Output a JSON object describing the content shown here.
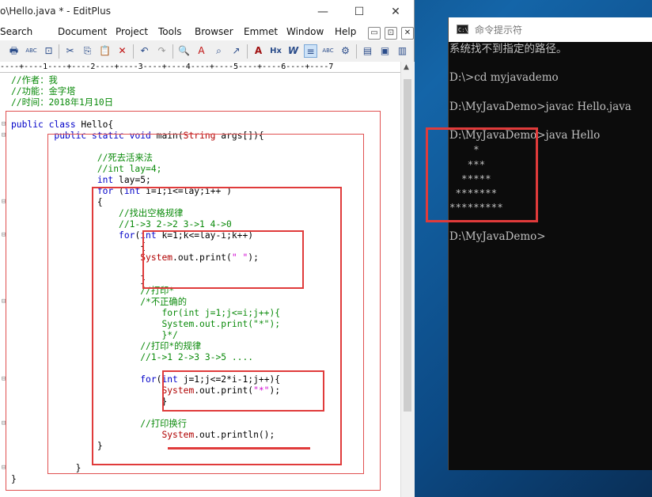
{
  "editplus": {
    "title": "o\\Hello.java * - EditPlus",
    "controls": {
      "minimize": "—",
      "maximize": "☐",
      "close": "✕"
    },
    "menu": [
      "Search",
      "Document",
      "Project",
      "Tools",
      "Browser",
      "Emmet",
      "Window",
      "Help"
    ],
    "menu_buttons": [
      "▭",
      "⊡",
      "✕"
    ],
    "ruler": "----+----1----+----2----+----3----+----4----+----5----+----6----+----7",
    "toolbar": {
      "print_icon": "🖶",
      "spell_icon": "ABC",
      "preview_icon": "⊡",
      "cut_icon": "✂",
      "copy_icon": "⎘",
      "paste_icon": "📋",
      "delete_icon": "✕",
      "undo_icon": "↶",
      "redo_icon": "↷",
      "find_icon": "🔍",
      "replace_icon": "A",
      "findfiles_icon": "⌕",
      "goto_icon": "↗",
      "font_icon": "A",
      "hex_icon": "Hx",
      "wordwrap_icon": "W",
      "lines_icon": "≡",
      "abc_icon": "ABC",
      "settings_icon": "⚙",
      "view1_icon": "▤",
      "view2_icon": "▣",
      "view3_icon": "▥"
    },
    "code_lines": [
      [
        {
          "c": "cm",
          "t": "//作者：我"
        }
      ],
      [
        {
          "c": "cm",
          "t": "//功能：金字塔"
        }
      ],
      [
        {
          "c": "cm",
          "t": "//时间：2018年1月10日"
        }
      ],
      [],
      [
        {
          "c": "kw",
          "t": "public class "
        },
        {
          "c": "tx",
          "t": "Hello{"
        }
      ],
      [
        {
          "c": "tx",
          "t": "        "
        },
        {
          "c": "kw",
          "t": "public static void "
        },
        {
          "c": "tx",
          "t": "main("
        },
        {
          "c": "ty",
          "t": "String"
        },
        {
          "c": "tx",
          "t": " args[]){"
        }
      ],
      [],
      [
        {
          "c": "tx",
          "t": "                "
        },
        {
          "c": "cm",
          "t": "//死去活来法"
        }
      ],
      [
        {
          "c": "tx",
          "t": "                "
        },
        {
          "c": "cm",
          "t": "//int lay=4;"
        }
      ],
      [
        {
          "c": "tx",
          "t": "                "
        },
        {
          "c": "kw",
          "t": "int "
        },
        {
          "c": "tx",
          "t": "lay=5;"
        }
      ],
      [
        {
          "c": "tx",
          "t": "                "
        },
        {
          "c": "kw",
          "t": "for "
        },
        {
          "c": "tx",
          "t": "("
        },
        {
          "c": "kw",
          "t": "int "
        },
        {
          "c": "tx",
          "t": "i=1;i<=lay;i++ )"
        }
      ],
      [
        {
          "c": "tx",
          "t": "                {"
        }
      ],
      [
        {
          "c": "tx",
          "t": "                    "
        },
        {
          "c": "cm",
          "t": "//找出空格规律"
        }
      ],
      [
        {
          "c": "tx",
          "t": "                    "
        },
        {
          "c": "cm",
          "t": "//1->3 2->2 3->1 4->0"
        }
      ],
      [
        {
          "c": "tx",
          "t": "                    "
        },
        {
          "c": "kw",
          "t": "for"
        },
        {
          "c": "tx",
          "t": "("
        },
        {
          "c": "kw",
          "t": "int "
        },
        {
          "c": "tx",
          "t": "k=1;k<=lay-i;k++)"
        }
      ],
      [
        {
          "c": "tx",
          "t": "                        {"
        }
      ],
      [
        {
          "c": "tx",
          "t": "                        "
        },
        {
          "c": "ty",
          "t": "System"
        },
        {
          "c": "tx",
          "t": ".out.print("
        },
        {
          "c": "st",
          "t": "\" \""
        },
        {
          "c": "tx",
          "t": ");"
        }
      ],
      [],
      [
        {
          "c": "tx",
          "t": "                        }"
        }
      ],
      [
        {
          "c": "tx",
          "t": "                        "
        },
        {
          "c": "cm",
          "t": "//打印*"
        }
      ],
      [
        {
          "c": "tx",
          "t": "                        "
        },
        {
          "c": "cm",
          "t": "/*不正确的"
        }
      ],
      [
        {
          "c": "tx",
          "t": "                            "
        },
        {
          "c": "cm",
          "t": "for(int j=1;j<=i;j++){"
        }
      ],
      [
        {
          "c": "tx",
          "t": "                            "
        },
        {
          "c": "cm",
          "t": "System.out.print(\"*\");"
        }
      ],
      [
        {
          "c": "tx",
          "t": "                            "
        },
        {
          "c": "cm",
          "t": "}*/"
        }
      ],
      [
        {
          "c": "tx",
          "t": "                        "
        },
        {
          "c": "cm",
          "t": "//打印*的规律"
        }
      ],
      [
        {
          "c": "tx",
          "t": "                        "
        },
        {
          "c": "cm",
          "t": "//1->1 2->3 3->5 ...."
        }
      ],
      [],
      [
        {
          "c": "tx",
          "t": "                        "
        },
        {
          "c": "kw",
          "t": "for"
        },
        {
          "c": "tx",
          "t": "("
        },
        {
          "c": "kw",
          "t": "int "
        },
        {
          "c": "tx",
          "t": "j=1;j<=2*i-1;j++){"
        }
      ],
      [
        {
          "c": "tx",
          "t": "                            "
        },
        {
          "c": "ty",
          "t": "System"
        },
        {
          "c": "tx",
          "t": ".out.print("
        },
        {
          "c": "st",
          "t": "\"*\""
        },
        {
          "c": "tx",
          "t": ");"
        }
      ],
      [
        {
          "c": "tx",
          "t": "                            }"
        }
      ],
      [],
      [
        {
          "c": "tx",
          "t": "                        "
        },
        {
          "c": "cm",
          "t": "//打印换行"
        }
      ],
      [
        {
          "c": "tx",
          "t": "                            "
        },
        {
          "c": "ty",
          "t": "System"
        },
        {
          "c": "tx",
          "t": ".out.println();"
        }
      ],
      [
        {
          "c": "tx",
          "t": "                }"
        }
      ],
      [],
      [
        {
          "c": "tx",
          "t": "            }"
        }
      ],
      [
        {
          "c": "tx",
          "t": "}"
        }
      ]
    ],
    "colors": {
      "comment": "#0a8a0a",
      "keyword": "#0000c8",
      "type": "#b00000",
      "string": "#d000d0",
      "annotation": "#e03b3b"
    }
  },
  "cmd": {
    "title": "命令提示符",
    "icon_text": "C:\\",
    "lines": [
      "系统找不到指定的路径。",
      "",
      "D:\\>cd myjavademo",
      "",
      "D:\\MyJavaDemo>javac Hello.java",
      "",
      "D:\\MyJavaDemo>java Hello",
      "    *",
      "   ***",
      "  *****",
      " *******",
      "*********",
      "",
      "D:\\MyJavaDemo>"
    ]
  }
}
